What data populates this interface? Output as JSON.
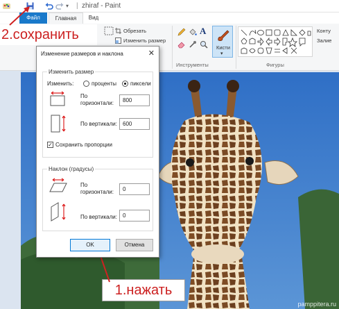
{
  "window": {
    "title": "zhiraf - Paint"
  },
  "tabs": {
    "file": "Файл",
    "home": "Главная",
    "view": "Вид"
  },
  "ribbon": {
    "crop": "Обрезать",
    "resize": "Изменить размер",
    "tools_label": "Инструменты",
    "brushes": "Кисти",
    "shapes_label": "Фигуры",
    "outline": "Конту",
    "fill": "Залие"
  },
  "annotations": {
    "step2": "2.сохранить",
    "step1": "1.нажать"
  },
  "watermark": "pamppitera.ru",
  "dialog": {
    "title": "Изменение размеров и наклона",
    "close": "✕",
    "resize_group": "Изменить размер",
    "change_by": "Изменить:",
    "percent": "проценты",
    "pixels": "пиксели",
    "horizontal_label_1": "По",
    "horizontal_label_2": "горизонтали:",
    "horizontal_value": "800",
    "vertical_label": "По вертикали:",
    "vertical_value": "600",
    "keep_ratio": "Сохранить пропорции",
    "skew_group": "Наклон (градусы)",
    "skew_h_label_1": "По",
    "skew_h_label_2": "горизонтали:",
    "skew_h_value": "0",
    "skew_v_label": "По вертикали:",
    "skew_v_value": "0",
    "ok": "OK",
    "cancel": "Отмена"
  },
  "colors": {
    "accent": "#1979ca",
    "annotation": "#cc2020",
    "sky": "#3f7fd0"
  }
}
